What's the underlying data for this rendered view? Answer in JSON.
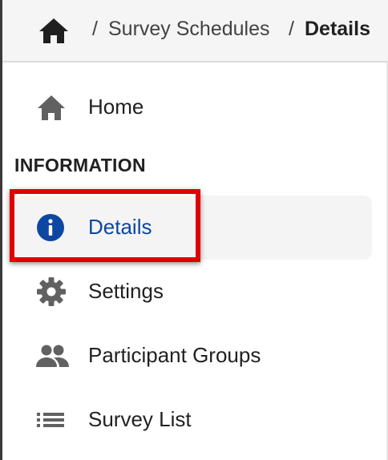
{
  "breadcrumb": {
    "home_icon": "home-icon",
    "separator": "/",
    "items": [
      {
        "label": "Survey Schedules"
      },
      {
        "label": "Details"
      }
    ]
  },
  "sidebar": {
    "home": {
      "label": "Home",
      "icon": "home-icon"
    },
    "section_heading": "INFORMATION",
    "items": [
      {
        "label": "Details",
        "icon": "info-icon",
        "active": true
      },
      {
        "label": "Settings",
        "icon": "gear-icon"
      },
      {
        "label": "Participant Groups",
        "icon": "people-icon"
      },
      {
        "label": "Survey List",
        "icon": "list-icon"
      }
    ]
  },
  "colors": {
    "active_text": "#0d47a1",
    "icon_gray": "#616161",
    "highlight_border": "#e00000"
  }
}
